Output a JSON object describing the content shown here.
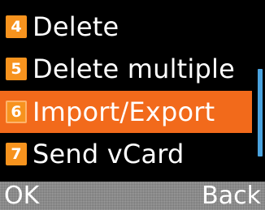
{
  "menu": {
    "items": [
      {
        "number": "4",
        "label": "Delete",
        "selected": false
      },
      {
        "number": "5",
        "label": "Delete multiple",
        "selected": false
      },
      {
        "number": "6",
        "label": "Import/Export",
        "selected": true
      },
      {
        "number": "7",
        "label": "Send vCard",
        "selected": false
      }
    ]
  },
  "softkeys": {
    "left_label": "OK",
    "right_label": "Back"
  },
  "colors": {
    "background": "#000000",
    "selection": "#f26a1b",
    "number_badge": "#f7931e",
    "scrollbar": "#4aa3df",
    "softkey_bar": "#8c8c8c",
    "text": "#ffffff"
  }
}
